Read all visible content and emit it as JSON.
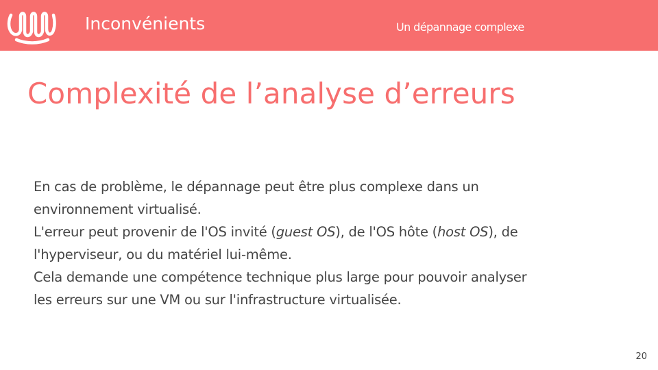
{
  "header": {
    "section_title": "Inconvénients",
    "section_subtitle": "Un dépannage complexe"
  },
  "slide": {
    "title": "Complexité de l’analyse d’erreurs",
    "paragraphs": [
      [
        {
          "text": "En cas de problème, le dépannage peut être plus complexe dans un"
        },
        {
          "text": "environnement virtualisé."
        }
      ],
      [
        {
          "text": "L'erreur peut provenir de l'OS invité (",
          "italic_term": "guest OS",
          "after": "), de l'OS hôte (",
          "italic_term2": "host OS",
          "after2": "), de"
        },
        {
          "text": "l'hyperviseur, ou du matériel lui-même."
        }
      ],
      [
        {
          "text": "Cela demande une compétence technique plus large pour pouvoir analyser"
        },
        {
          "text": "les erreurs sur une VM ou sur l'infrastructure virtualisée."
        }
      ]
    ],
    "page_number": "20"
  },
  "colors": {
    "accent": "#f76e6e",
    "text": "#454545",
    "background": "#ffffff"
  },
  "icons": {
    "logo": "brand-logo-icon"
  }
}
